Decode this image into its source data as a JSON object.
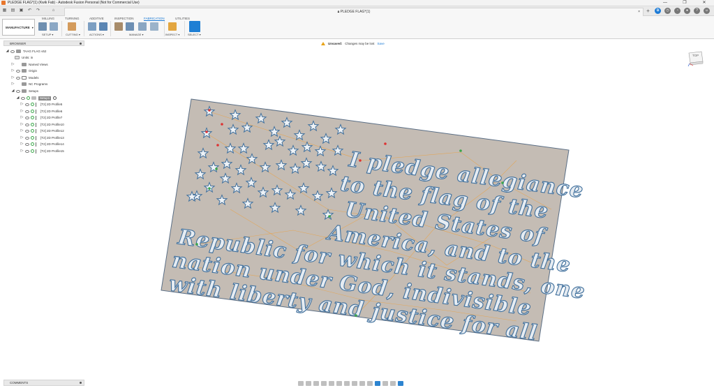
{
  "window": {
    "title": "PLEDGE FLAG*(1) (Kwik Fab) - Autodesk Fusion Personal (Not for Commercial Use)",
    "controls": [
      "—",
      "❐",
      "✕"
    ]
  },
  "doc_tab": {
    "title": "PLEDGE FLAG*(1)",
    "close": "×"
  },
  "ribbon": {
    "workspace": "MANUFACTURE",
    "tabs": [
      "MILLING",
      "TURNING",
      "ADDITIVE",
      "INSPECTION",
      "FABRICATION",
      "UTILITIES"
    ],
    "active_tab": "FABRICATION",
    "groups": [
      "SETUP ▾",
      "CUTTING ▾",
      "ACTIONS ▾",
      "MANAGE ▾",
      "INSPECT ▾",
      "SELECT ▾"
    ]
  },
  "browser": {
    "title": "BROWSER",
    "root": "TAAG FLAG v52",
    "items": [
      "Units: in",
      "Named Views",
      "Origin",
      "Models",
      "NC Programs",
      "Setups"
    ],
    "setup": "Setup1",
    "operations": [
      "[T2] 2D Profile5",
      "[T2] 2D Profile6",
      "[T2] 2D Profile7",
      "[T2] 2D Profile10",
      "[T2] 2D Profile12",
      "[T2] 2D Profile13",
      "[T2] 2D Profile14",
      "[T2] 2D Profile15"
    ]
  },
  "notice": {
    "status": "Unsaved:",
    "message": "Changes may be lost",
    "action": "Save"
  },
  "viewcube": {
    "label": "TOP"
  },
  "comments": {
    "title": "COMMENTS"
  },
  "canvas": {
    "plate_color": "#c4bcb4",
    "text_color": "#e6ecf2",
    "outline_color": "#3f6f9c",
    "toolpath_color": "#e8a34a",
    "pledge_lines": [
      "I pledge allegiance",
      "to the flag of the",
      "United States of",
      "America, and to the",
      "Republic for which it stands, one",
      "nation under God, indivisible",
      "with liberty and justice for all"
    ]
  }
}
